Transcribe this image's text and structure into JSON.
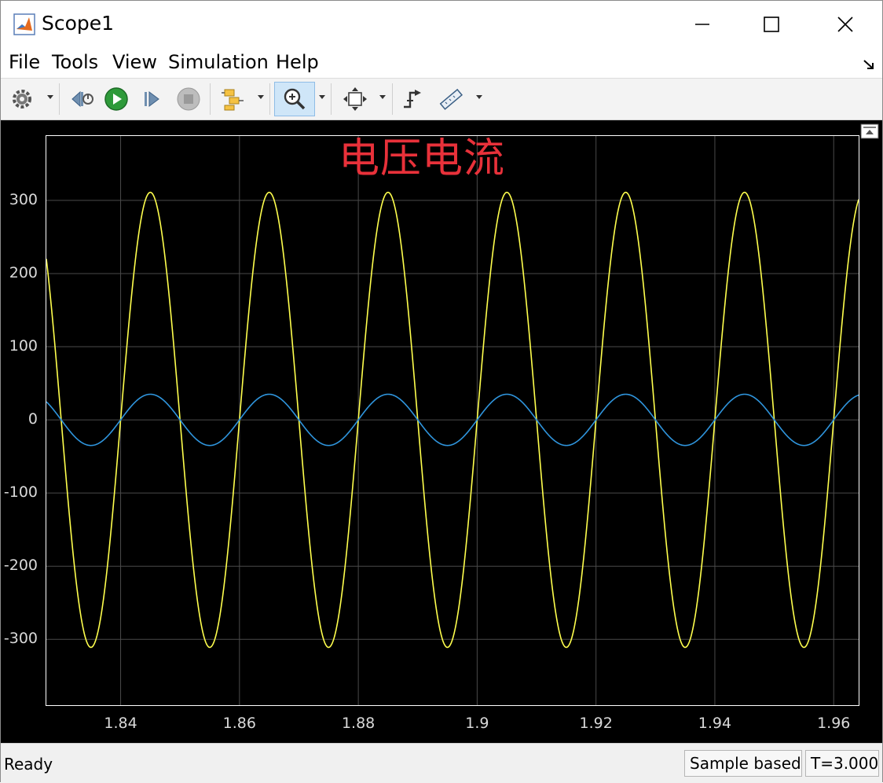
{
  "window": {
    "title": "Scope1"
  },
  "menu": {
    "file": "File",
    "tools": "Tools",
    "view": "View",
    "simulation": "Simulation",
    "help": "Help"
  },
  "toolbar": {
    "icons": [
      "gear-icon",
      "step-back-icon",
      "run-icon",
      "step-forward-icon",
      "stop-icon",
      "signal-select-icon",
      "zoom-in-icon",
      "fit-to-view-icon",
      "trigger-icon",
      "measure-icon"
    ]
  },
  "plot": {
    "title": "电压电流",
    "background": "#000000"
  },
  "chart_data": {
    "type": "line",
    "title": "电压电流",
    "xlabel": "",
    "ylabel": "",
    "xlim": [
      1.8275,
      1.9642
    ],
    "ylim": [
      -390,
      388
    ],
    "x_ticks": [
      1.84,
      1.86,
      1.88,
      1.9,
      1.92,
      1.94,
      1.96
    ],
    "x_tick_labels": [
      "1.84",
      "1.86",
      "1.88",
      "1.9",
      "1.92",
      "1.94",
      "1.96"
    ],
    "y_ticks": [
      300,
      200,
      100,
      0,
      -100,
      -200,
      -300
    ],
    "y_tick_labels": [
      "300",
      "200",
      "100",
      "0",
      "-100",
      "-200",
      "-300"
    ],
    "grid": true,
    "series": [
      {
        "color": "#ffff4d",
        "amplitude": 311,
        "frequency_hz": 50,
        "peak_times": [
          1.845,
          1.865,
          1.885,
          1.905,
          1.925,
          1.945,
          1.965
        ]
      },
      {
        "color": "#2f95dd",
        "amplitude": 35,
        "frequency_hz": 50,
        "peak_times": [
          1.845,
          1.865,
          1.885,
          1.905,
          1.925,
          1.945,
          1.965
        ]
      }
    ]
  },
  "status": {
    "ready": "Ready",
    "mode": "Sample based",
    "time": "T=3.000"
  }
}
